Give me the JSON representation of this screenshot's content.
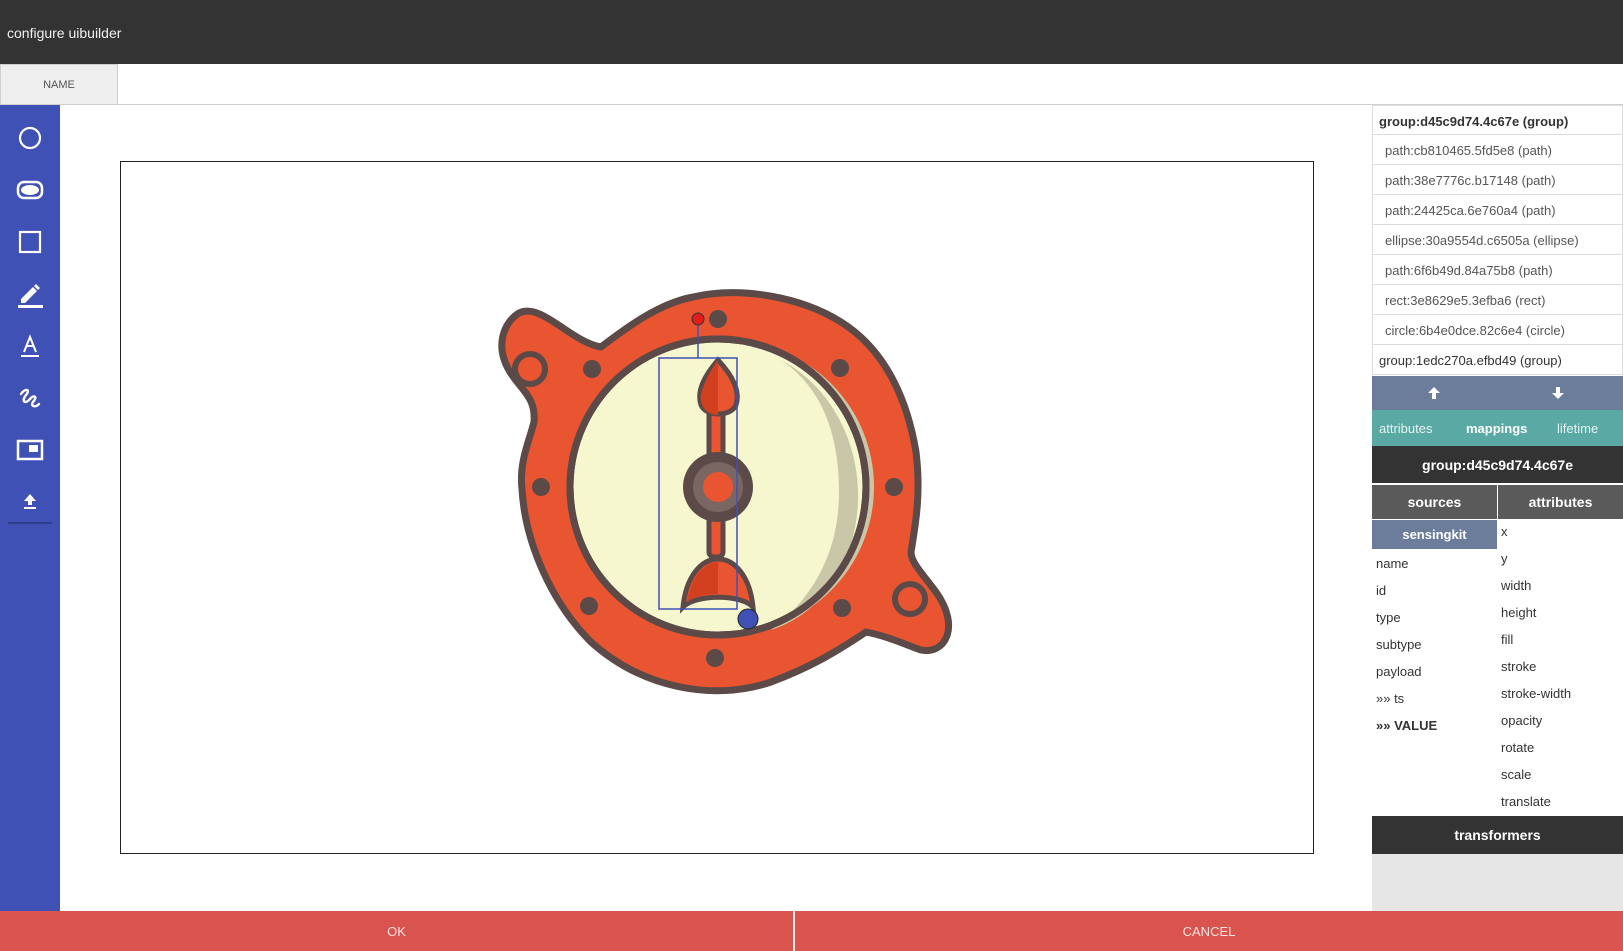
{
  "window": {
    "title": "configure uibuilder"
  },
  "name_tab": {
    "label": "NAME"
  },
  "toolbar": {
    "tools": [
      "circle-tool",
      "ellipse-tool",
      "rect-tool",
      "pen-tool",
      "text-tool",
      "freehand-tool",
      "image-tool",
      "upload-tool"
    ]
  },
  "tree": {
    "items": [
      {
        "label": "group:d45c9d74.4c67e (group)",
        "kind": "group",
        "selected": true
      },
      {
        "label": "path:cb810465.5fd5e8 (path)",
        "kind": "child"
      },
      {
        "label": "path:38e7776c.b17148 (path)",
        "kind": "child"
      },
      {
        "label": "path:24425ca.6e760a4 (path)",
        "kind": "child"
      },
      {
        "label": "ellipse:30a9554d.c6505a (ellipse)",
        "kind": "child"
      },
      {
        "label": "path:6f6b49d.84a75b8 (path)",
        "kind": "child"
      },
      {
        "label": "rect:3e8629e5.3efba6 (rect)",
        "kind": "child"
      },
      {
        "label": "circle:6b4e0dce.82c6e4 (circle)",
        "kind": "child"
      },
      {
        "label": "group:1edc270a.efbd49 (group)",
        "kind": "group"
      }
    ]
  },
  "tabs": {
    "items": [
      {
        "label": "attributes",
        "active": false
      },
      {
        "label": "mappings",
        "active": true
      },
      {
        "label": "lifetime",
        "active": false
      }
    ]
  },
  "mapping": {
    "node_title": "group:d45c9d74.4c67e",
    "sources_header": "sources",
    "attributes_header": "attributes",
    "source_name": "sensingkit",
    "source_fields": [
      "name",
      "id",
      "type",
      "subtype",
      "payload",
      "»» ts",
      "»» VALUE"
    ],
    "attribute_fields": [
      "x",
      "y",
      "width",
      "height",
      "fill",
      "stroke",
      "stroke-width",
      "opacity",
      "rotate",
      "scale",
      "translate"
    ],
    "transformers_label": "transformers"
  },
  "footer": {
    "ok_label": "OK",
    "cancel_label": "CANCEL"
  },
  "colors": {
    "toolbar": "#3f51b5",
    "gauge_orange": "#e95530",
    "gauge_outline": "#5b4a47",
    "gauge_face": "#f7f7cf",
    "gauge_shadow": "#c9c7a8",
    "footer": "#d9534f",
    "tabs_bar": "#5aa9a5",
    "selection": "#3f51b5",
    "rotate_handle": "#e31b1b"
  }
}
